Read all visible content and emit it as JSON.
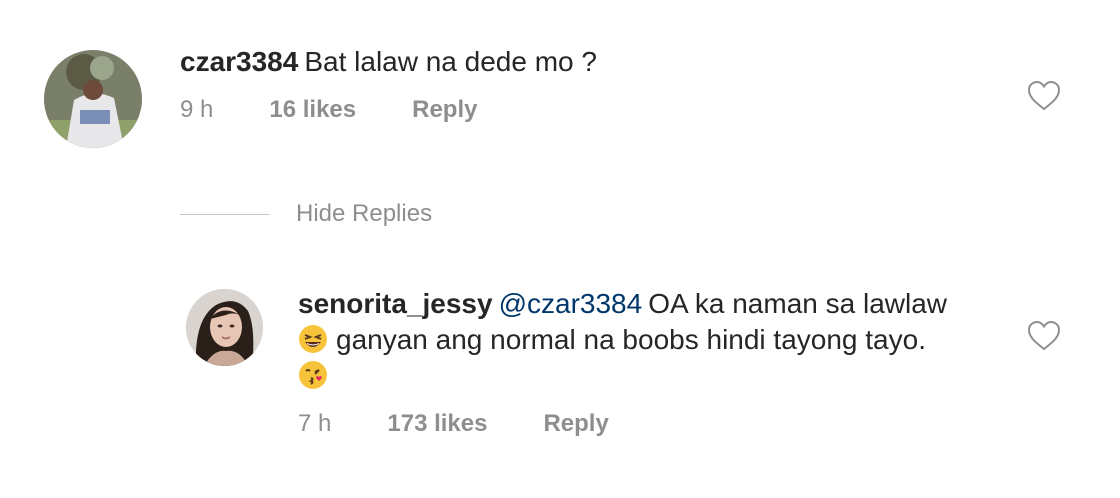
{
  "comments": [
    {
      "username": "czar3384",
      "text": "Bat lalaw na dede mo ?",
      "time": "9 h",
      "likes": "16 likes",
      "reply_label": "Reply",
      "avatar_icon": "user-photo-avatar",
      "like_icon": "heart-outline-icon"
    }
  ],
  "hide_replies_label": "Hide Replies",
  "reply": {
    "username": "senorita_jessy",
    "mention": "@czar3384",
    "text_line1": "OA ka naman sa lawlaw",
    "text_line2": "ganyan ang normal na boobs hindi tayong tayo.",
    "emoji_1": "grinning-squinting-face-emoji",
    "emoji_2": "face-blowing-kiss-emoji",
    "time": "7 h",
    "likes": "173 likes",
    "reply_label": "Reply",
    "avatar_icon": "user-photo-avatar",
    "like_icon": "heart-outline-icon"
  },
  "colors": {
    "text": "#262626",
    "secondary": "#8e8e8e",
    "mention": "#00376b",
    "divider": "#c7c7c7"
  }
}
